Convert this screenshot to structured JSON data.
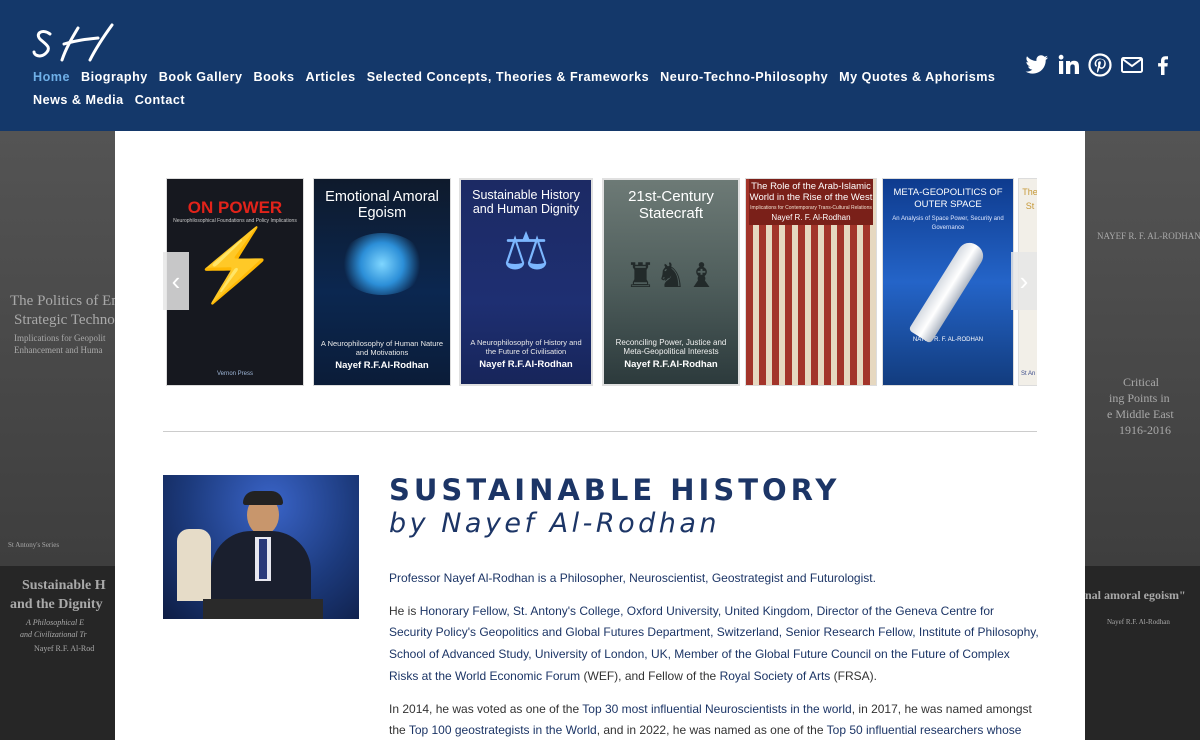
{
  "header": {
    "logo_text": "SH",
    "nav_row1": [
      "Home",
      "Biography",
      "Book Gallery",
      "Books",
      "Articles",
      "Selected Concepts, Theories & Frameworks",
      "Neuro-Techno-Philosophy",
      "My Quotes & Aphorisms"
    ],
    "nav_row2": [
      "News & Media",
      "Contact"
    ],
    "active_item": "Home",
    "social": [
      "twitter-icon",
      "linkedin-icon",
      "pinterest-icon",
      "email-icon",
      "facebook-icon"
    ]
  },
  "background": {
    "left_text1": "The Politics of Em",
    "left_text2": "Strategic Techno",
    "left_text3": "Implications for Geopolit",
    "left_text4": "Enhancement and Huma",
    "left_series": "St Antony's Series",
    "left_book1": "Sustainable H",
    "left_book2": "and the Dignity",
    "left_book3": "A Philosophical E",
    "left_book4": "and Civilizational Tr",
    "left_book5": "Nayef R.F. Al-Rod",
    "right_text1": "NAYEF R. F. AL-RODHAN",
    "right_text2": "Critical",
    "right_text3": "ing Points in",
    "right_text4": "e Middle East",
    "right_text5": "1916-2016",
    "right_text6": "nal amoral egoism\"",
    "right_text7": "Nayef R.F. Al-Rodhan",
    "colors": {
      "header": "#14386a",
      "accent": "#6fb0e8",
      "title": "#1c3566"
    }
  },
  "carousel": {
    "books": [
      {
        "title": "ON POWER",
        "subtitle": "Neurophilosophical Foundations and Policy Implications",
        "author": "Nayef R. F. Al-Rodhan",
        "publisher": "Vernon Press"
      },
      {
        "title": "Emotional Amoral Egoism",
        "subtitle": "A Neurophilosophy of Human Nature and Motivations",
        "author": "Nayef R.F.Al-Rodhan"
      },
      {
        "title": "Sustainable History and Human Dignity",
        "subtitle": "A Neurophilosophy of History and the Future of Civilisation",
        "author": "Nayef R.F.Al-Rodhan"
      },
      {
        "title": "21st-Century Statecraft",
        "subtitle": "Reconciling Power, Justice and Meta-Geopolitical Interests",
        "author": "Nayef R.F.Al-Rodhan"
      },
      {
        "title": "The Role of the Arab-Islamic World in the Rise of the West",
        "subtitle": "Implications for Contemporary Trans-Cultural Relations",
        "author": "Nayef R. F. Al-Rodhan"
      },
      {
        "title": "META-GEOPOLITICS OF OUTER SPACE",
        "subtitle": "An Analysis of Space Power, Security and Governance",
        "author": "NAYEF R. F. AL-RODHAN"
      },
      {
        "title": "The St",
        "subtitle": "",
        "author": "St An"
      }
    ],
    "prev_glyph": "‹",
    "next_glyph": "›"
  },
  "main": {
    "title": "SUSTAINABLE HISTORY",
    "subtitle": "by Nayef Al-Rodhan",
    "p1": "Professor Nayef Al-Rodhan is a Philosopher, Neuroscientist, Geostrategist and Futurologist.",
    "p2_a": "He is ",
    "p2_link": "Honorary Fellow, St. Antony's College, Oxford University, United Kingdom, Director of the Geneva Centre for Security Policy's Geopolitics and Global Futures Department, Switzerland, Senior Research Fellow, Institute of Philosophy, School of Advanced Study, University of London, UK, Member of the Global Future Council on the Future of Complex Risks at the World Economic Forum",
    "p2_b": " (WEF), and Fellow of the ",
    "p2_link2": "Royal Society of Arts",
    "p2_c": " (FRSA).",
    "p3_a": "In 2014, he was voted as one of the ",
    "p3_link1": "Top 30 most influential Neuroscientists in the world",
    "p3_b": ", in 2017, he was named amongst the ",
    "p3_link2": "Top 100 geostrategists in the World",
    "p3_c": ", and in 2022, he was named as one of the ",
    "p3_link3": "Top 50 influential researchers whose"
  }
}
